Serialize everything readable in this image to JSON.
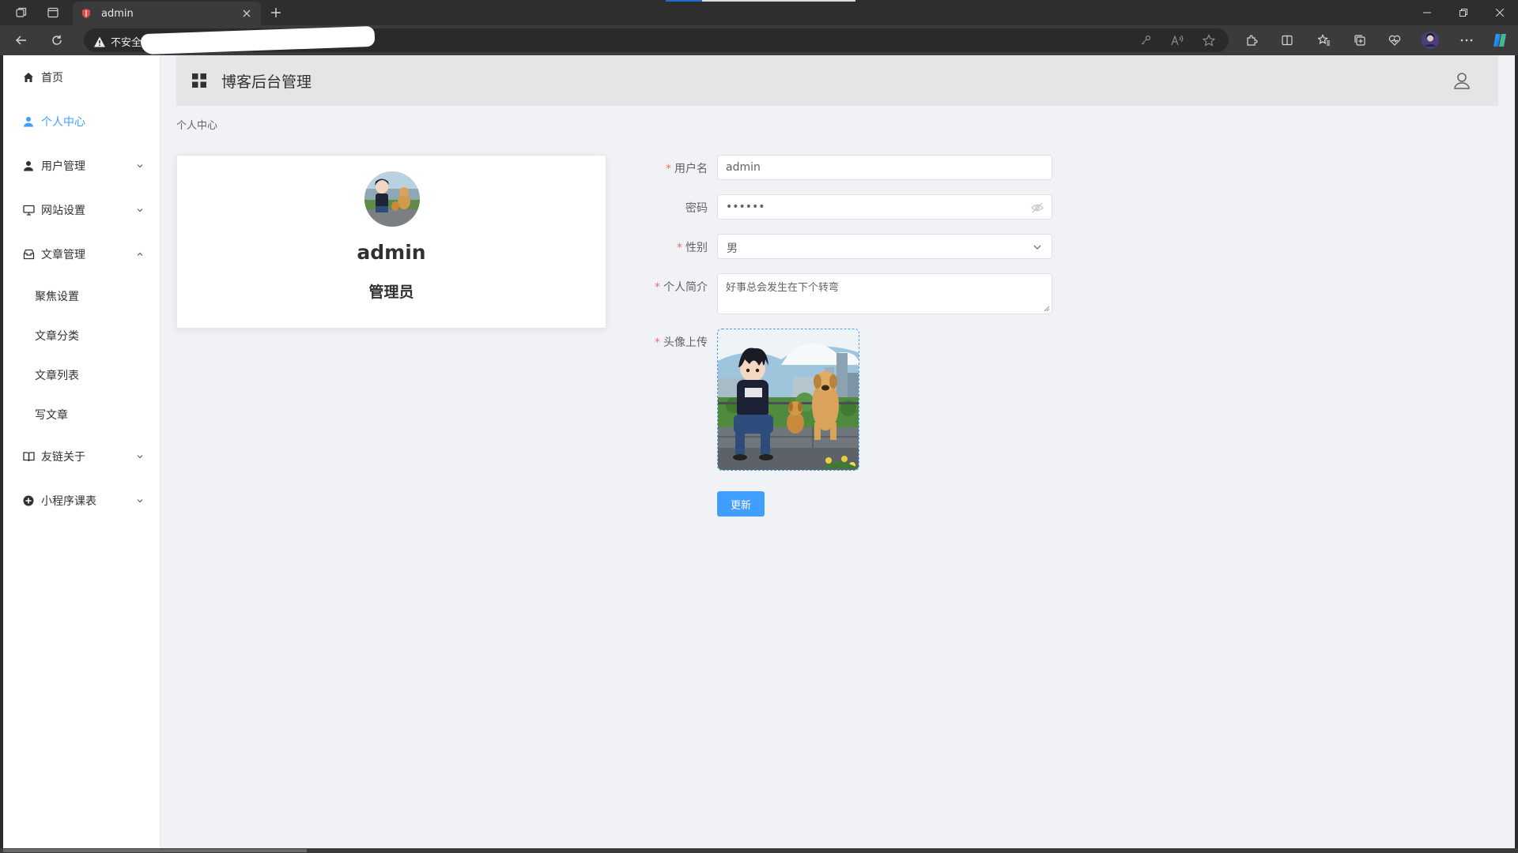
{
  "browser": {
    "tab_title": "admin",
    "security_label": "不安全",
    "colors": {
      "chrome_dark": "#2e2e2e",
      "chrome": "#3b3b3b",
      "accent": "#1f6fd1"
    }
  },
  "sidebar": {
    "items": [
      {
        "label": "首页",
        "icon": "home-icon"
      },
      {
        "label": "个人中心",
        "icon": "user-icon",
        "active": true
      },
      {
        "label": "用户管理",
        "icon": "user-group-icon"
      },
      {
        "label": "网站设置",
        "icon": "monitor-icon"
      },
      {
        "label": "文章管理",
        "icon": "box-icon"
      },
      {
        "label": "友链关于",
        "icon": "book-icon"
      },
      {
        "label": "小程序课表",
        "icon": "plus-circle-icon"
      }
    ],
    "article_submenu": [
      "聚焦设置",
      "文章分类",
      "文章列表",
      "写文章"
    ]
  },
  "header": {
    "title": "博客后台管理"
  },
  "breadcrumb": "个人中心",
  "profile": {
    "name": "admin",
    "role": "管理员"
  },
  "form": {
    "username": {
      "label": "用户名",
      "value": "admin"
    },
    "password": {
      "label": "密码",
      "value": "123456"
    },
    "gender": {
      "label": "性别",
      "value": "男"
    },
    "bio": {
      "label": "个人简介",
      "value": "好事总会发生在下个转弯"
    },
    "avatar": {
      "label": "头像上传"
    },
    "submit_label": "更新"
  },
  "colors": {
    "primary": "#409eff",
    "required": "#f56c6c",
    "header_bg": "#e5e5e5",
    "page_bg": "#f0f2f5"
  }
}
